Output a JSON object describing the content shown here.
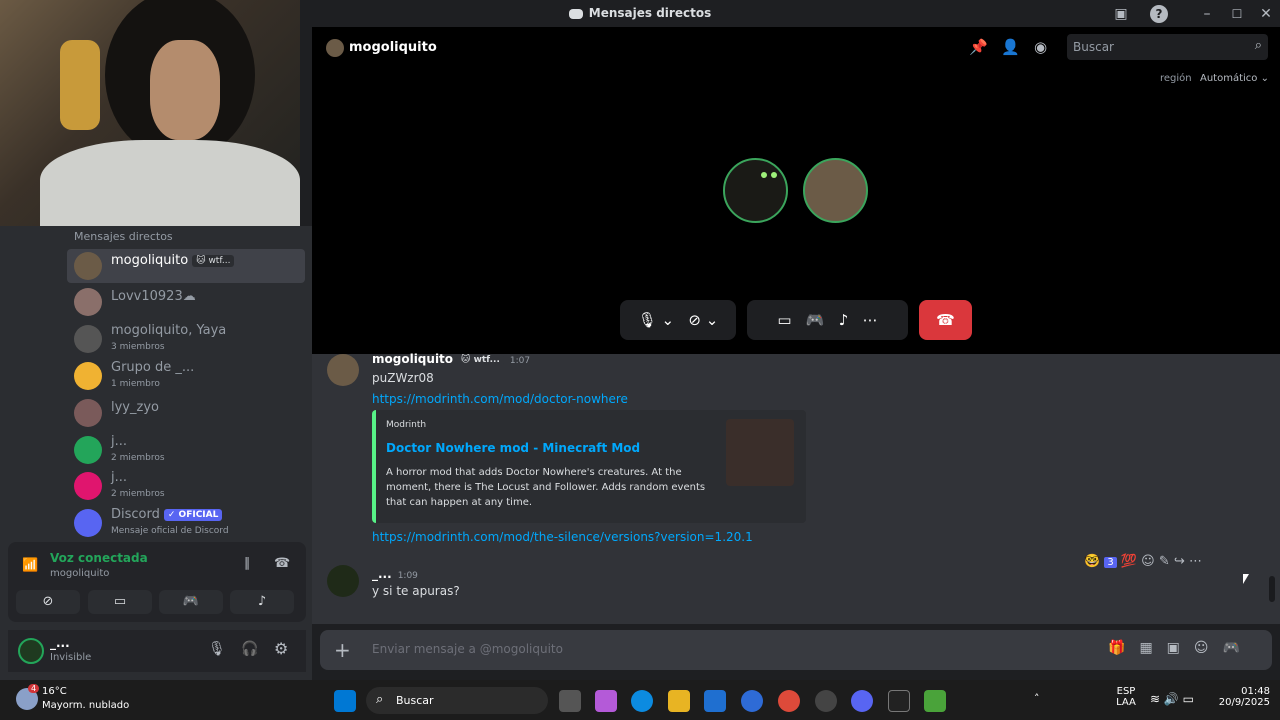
{
  "titlebar": {
    "title": "Mensajes directos"
  },
  "sidebar": {
    "header": "Mensajes directos",
    "dms": [
      {
        "name": "mogoliquito",
        "tag": "🐱 wtf...",
        "sub": ""
      },
      {
        "name": "Lovv10923☁",
        "tag": "",
        "sub": ""
      },
      {
        "name": "mogoliquito, Yaya",
        "tag": "",
        "sub": "3 miembros"
      },
      {
        "name": "Grupo de _...",
        "tag": "",
        "sub": "1 miembro"
      },
      {
        "name": "lyy_zyo",
        "tag": "",
        "sub": ""
      },
      {
        "name": "j...",
        "tag": "",
        "sub": "2 miembros"
      },
      {
        "name": "j...",
        "tag": "",
        "sub": "2 miembros"
      },
      {
        "name": "Discord",
        "tag": "✓ OFICIAL",
        "sub": "Mensaje oficial de Discord"
      }
    ],
    "voice": {
      "status": "Voz conectada",
      "channel": "mogoliquito"
    },
    "user": {
      "name": "_...",
      "status": "Invisible"
    }
  },
  "call": {
    "channel_name": "mogoliquito",
    "search_placeholder": "Buscar",
    "region_label": "región",
    "region_value": "Automático"
  },
  "chat": {
    "messages": [
      {
        "author": "mogoliquito",
        "tag": "🐱 wtf...",
        "time": "1:07",
        "text": "puZWzr08",
        "link1": "https://modrinth.com/mod/doctor-nowhere",
        "embed": {
          "provider": "Modrinth",
          "title": "Doctor Nowhere mod - Minecraft Mod",
          "description": "A horror mod that adds Doctor Nowhere's creatures. At the moment, there is The Locust and Follower. Adds random events that can happen at any time."
        },
        "link2": "https://modrinth.com/mod/the-silence/versions?version=1.20.1"
      },
      {
        "author": "_...",
        "time": "1:09",
        "text": "y si te apuras?"
      }
    ],
    "reaction_count": "3",
    "input_placeholder": "Enviar mensaje a @mogoliquito"
  },
  "taskbar": {
    "weather_temp": "16°C",
    "weather_desc": "Mayorm. nublado",
    "weather_badge": "4",
    "search_label": "Buscar",
    "lang": "ESP",
    "layout": "LAA",
    "time": "01:48",
    "date": "20/9/2025"
  },
  "colors": {
    "accent": "#5865f2",
    "link": "#00a8fc",
    "hangup": "#da373c",
    "online": "#23a55a"
  }
}
